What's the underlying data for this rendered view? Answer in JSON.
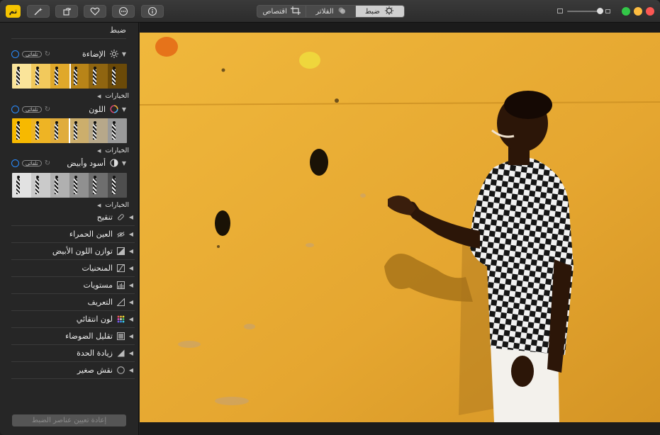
{
  "toolbar": {
    "done_label": "تم",
    "tabs": [
      {
        "label": "ضبط",
        "icon": "adjust-icon",
        "active": true
      },
      {
        "label": "الفلاتر",
        "icon": "filters-icon",
        "active": false
      },
      {
        "label": "اقتصاص",
        "icon": "crop-icon",
        "active": false
      }
    ],
    "traffic_colors": {
      "close": "#fc5753",
      "minimize": "#fdbc40",
      "zoom": "#33c748"
    },
    "accent": "#f5c400"
  },
  "sidebar": {
    "title": "ضبط",
    "sections": [
      {
        "name": "الإضاءة",
        "icon": "light-icon",
        "auto_label": "تلقائي",
        "options_label": "الخيارات",
        "strip_style": "light"
      },
      {
        "name": "اللون",
        "icon": "color-icon",
        "auto_label": "تلقائي",
        "options_label": "الخيارات",
        "strip_style": "color"
      },
      {
        "name": "أسود وأبيض",
        "icon": "black-white-icon",
        "auto_label": "تلقائي",
        "options_label": "الخيارات",
        "strip_style": "bw"
      }
    ],
    "tools": [
      {
        "name": "تنقيح",
        "icon": "retouch-icon"
      },
      {
        "name": "العين الحمراء",
        "icon": "red-eye-icon"
      },
      {
        "name": "توازن اللون الأبيض",
        "icon": "white-balance-icon"
      },
      {
        "name": "المنحنيات",
        "icon": "curves-icon"
      },
      {
        "name": "مستويات",
        "icon": "levels-icon"
      },
      {
        "name": "التعريف",
        "icon": "definition-icon"
      },
      {
        "name": "لون انتقائي",
        "icon": "selective-color-icon"
      },
      {
        "name": "تقليل الضوضاء",
        "icon": "noise-reduction-icon"
      },
      {
        "name": "زيادة الحدة",
        "icon": "sharpen-icon"
      },
      {
        "name": "نقش صغير",
        "icon": "vignette-icon"
      }
    ],
    "reset_label": "إعادة تعيين عناصر الضبط"
  },
  "photo": {
    "description_icon": "photo-image"
  }
}
